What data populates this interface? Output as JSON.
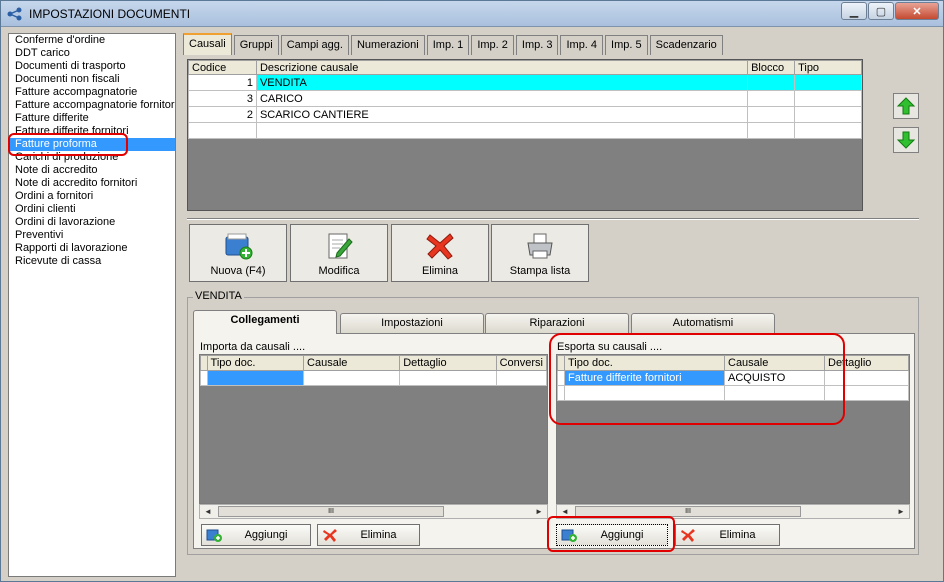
{
  "window": {
    "title": "IMPOSTAZIONI DOCUMENTI"
  },
  "doc_list": [
    "Conferme d'ordine",
    "DDT carico",
    "Documenti di trasporto",
    "Documenti non fiscali",
    "Fatture accompagnatorie",
    "Fatture accompagnatorie fornitori",
    "Fatture differite",
    "Fatture differite fornitori",
    "Fatture proforma",
    "Carichi di produzione",
    "Note di accredito",
    "Note di accredito fornitori",
    "Ordini a fornitori",
    "Ordini clienti",
    "Ordini di lavorazione",
    "Preventivi",
    "Rapporti di lavorazione",
    "Ricevute di cassa"
  ],
  "selected_doc_index": 8,
  "tabs": [
    "Causali",
    "Gruppi",
    "Campi agg.",
    "Numerazioni",
    "Imp. 1",
    "Imp. 2",
    "Imp. 3",
    "Imp. 4",
    "Imp. 5",
    "Scadenzario"
  ],
  "causali_grid": {
    "headers": {
      "codice": "Codice",
      "descrizione": "Descrizione causale",
      "blocco": "Blocco",
      "tipo": "Tipo"
    },
    "rows": [
      {
        "codice": "1",
        "descrizione": "VENDITA"
      },
      {
        "codice": "3",
        "descrizione": "CARICO"
      },
      {
        "codice": "2",
        "descrizione": "SCARICO CANTIERE"
      }
    ]
  },
  "toolbar": {
    "nuova": "Nuova (F4)",
    "modifica": "Modifica",
    "elimina": "Elimina",
    "stampa": "Stampa lista"
  },
  "group_title": "VENDITA",
  "panel_tabs": [
    "Collegamenti",
    "Impostazioni",
    "Riparazioni",
    "Automatismi"
  ],
  "importa": {
    "title": "Importa da causali ....",
    "headers": [
      "Tipo doc.",
      "Causale",
      "Dettaglio",
      "Conversi"
    ],
    "add_label": "Aggiungi",
    "del_label": "Elimina"
  },
  "esporta": {
    "title": "Esporta su causali ....",
    "headers": [
      "Tipo doc.",
      "Causale",
      "Dettaglio"
    ],
    "row": {
      "tipo": "Fatture differite fornitori",
      "causale": "ACQUISTO"
    },
    "add_label": "Aggiungi",
    "del_label": "Elimina"
  },
  "scroll_grip": "III",
  "colors": {
    "selection": "#3399ff",
    "highlight_row": "#00ffff",
    "annotation": "#e00000"
  }
}
